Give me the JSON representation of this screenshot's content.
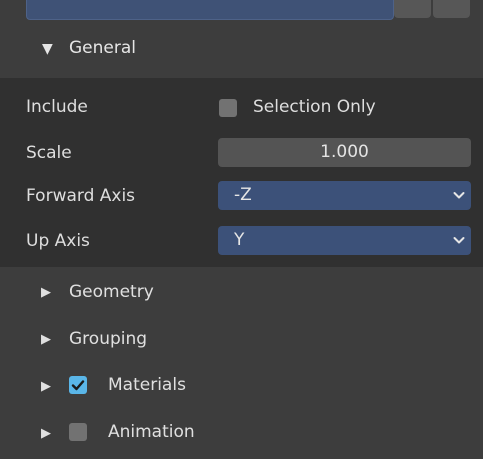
{
  "panel": {
    "section": {
      "arrow": "▼",
      "title": "General"
    },
    "props": {
      "include_label": "Include",
      "selection_only_label": "Selection Only",
      "selection_only_checked": false,
      "scale_label": "Scale",
      "scale_value": "1.000",
      "forward_axis_label": "Forward Axis",
      "forward_axis_value": "-Z",
      "up_axis_label": "Up Axis",
      "up_axis_value": "Y"
    },
    "subpanels": [
      {
        "arrow": "▶",
        "label": "Geometry"
      },
      {
        "arrow": "▶",
        "label": "Grouping"
      },
      {
        "arrow": "▶",
        "label": "Materials",
        "checked": true
      },
      {
        "arrow": "▶",
        "label": "Animation",
        "checked": false
      }
    ]
  },
  "colors": {
    "panel_bg": "#3d3d3d",
    "content_bg": "#303030",
    "enum_bg": "#3c5179",
    "checkbox_checked": "#5ab6e8"
  },
  "icons": {
    "expanded": "triangle-down-icon",
    "collapsed": "triangle-right-icon",
    "dropdown": "chevron-down-icon",
    "check": "checkmark-icon"
  }
}
